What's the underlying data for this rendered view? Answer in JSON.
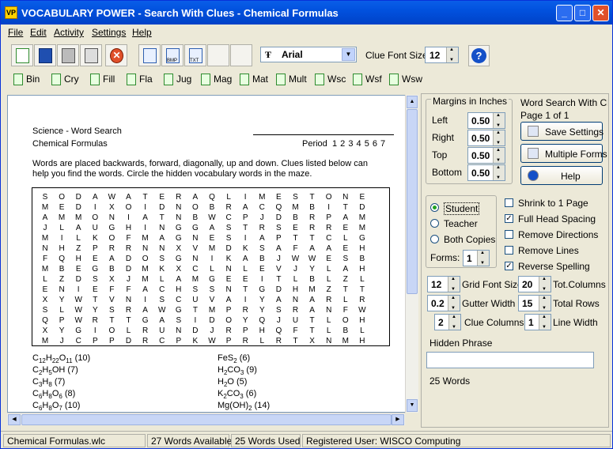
{
  "window": {
    "title": "VOCABULARY POWER - Search With Clues - Chemical Formulas"
  },
  "menu": [
    "File",
    "Edit",
    "Activity",
    "Settings",
    "Help"
  ],
  "toolbar": {
    "font": "Arial",
    "clue_font_size_label": "Clue Font Size:",
    "clue_font_size": "12"
  },
  "format_tabs": [
    "Bin",
    "Cry",
    "Fill",
    "Fla",
    "Jug",
    "Mag",
    "Mat",
    "Mult",
    "Wsc",
    "Wsf",
    "Wsw"
  ],
  "doc": {
    "header_left": "Science - Word Search",
    "subtitle": "Chemical Formulas",
    "period_label": "Period",
    "periods": "1 2 3 4 5 6 7",
    "instructions_1": "Words are placed backwards, forward, diagonally, up and down. Clues listed below can",
    "instructions_2": "help you find the words. Circle the hidden vocabulary words in the maze.",
    "maze": [
      "SODAWATERAQLIMESTONE",
      "MEDIXOIDNOBRACQMBITD",
      "AMMONIATNBWCPJDBRPAM",
      "JLAUGHINGGASTRSERREM",
      "MILKOFMAGNESIAPTTCLG",
      "NHZPRRNNXVMDKSAFAAEH",
      "FQHEADOSGNIKABJWWESB",
      "MBEGBDMKXCLNLEVJYLAH",
      "LZDSXJMLAMGEEITLBLZL",
      "ENIEFFACHSSNTGDHMZTT",
      "XYWTVNISCUVAIYANARLR",
      "SLWYSRAWGTMPRYSRANFW",
      "QPWRTTGASIDOYQJUTLOH",
      "XYGIOLRUNDJRPHQFTLBL",
      "MJCPPDRCPKWPRLRTXNMH"
    ],
    "clues_left": [
      {
        "f": "C<sub>12</sub>H<sub>22</sub>O<sub>11</sub>",
        "n": "(10)"
      },
      {
        "f": "C<sub>2</sub>H<sub>5</sub>OH",
        "n": "(7)"
      },
      {
        "f": "C<sub>3</sub>H<sub>8</sub>",
        "n": "(7)"
      },
      {
        "f": "C<sub>6</sub>H<sub>8</sub>O<sub>6</sub>",
        "n": "(8)"
      },
      {
        "f": "C<sub>6</sub>H<sub>8</sub>O<sub>7</sub>",
        "n": "(10)"
      }
    ],
    "clues_right": [
      {
        "f": "FeS<sub>2</sub>",
        "n": "(6)"
      },
      {
        "f": "H<sub>2</sub>CO<sub>3</sub>",
        "n": "(9)"
      },
      {
        "f": "H<sub>2</sub>O",
        "n": "(5)"
      },
      {
        "f": "K<sub>2</sub>CO<sub>3</sub>",
        "n": "(6)"
      },
      {
        "f": "Mg(OH)<sub>2</sub>",
        "n": "(14)"
      }
    ]
  },
  "margins": {
    "title": "Margins in Inches",
    "left_label": "Left",
    "left": "0.50",
    "right_label": "Right",
    "right": "0.50",
    "top_label": "Top",
    "top": "0.50",
    "bottom_label": "Bottom",
    "bottom": "0.50"
  },
  "info": {
    "line1": "Word Search With Clue",
    "line2": "Page 1 of 1"
  },
  "buttons": {
    "save": "Save Settings",
    "multiple": "Multiple Forms",
    "help": "Help"
  },
  "version": {
    "student": "Student",
    "teacher": "Teacher",
    "both": "Both Copies",
    "forms_label": "Forms:",
    "forms": "1"
  },
  "options": {
    "shrink": "Shrink to 1 Page",
    "head_spacing": "Full Head Spacing",
    "remove_directions": "Remove Directions",
    "remove_lines": "Remove Lines",
    "reverse_spelling": "Reverse Spelling"
  },
  "grid": {
    "grid_font_size": "12",
    "grid_font_size_label": "Grid Font Size",
    "tot_columns": "20",
    "tot_columns_label": "Tot.Columns",
    "gutter": "0.2",
    "gutter_label": "Gutter Width",
    "total_rows": "15",
    "total_rows_label": "Total Rows",
    "clue_columns": "2",
    "clue_columns_label": "Clue Columns",
    "line_width": "1",
    "line_width_label": "Line Width"
  },
  "hidden_phrase": {
    "label": "Hidden Phrase",
    "value": ""
  },
  "word_count": "25 Words",
  "status": {
    "file": "Chemical Formulas.wlc",
    "available": "27 Words Available",
    "used": "25 Words Used",
    "user": "Registered User:  WISCO Computing"
  }
}
